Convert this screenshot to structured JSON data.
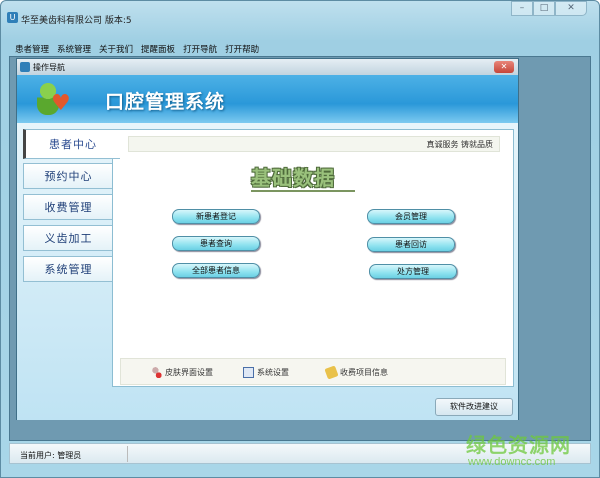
{
  "app": {
    "title": "华至美齿科有限公司  版本:5",
    "controls": {
      "minimize": "–",
      "maximize": "□",
      "close": "✕"
    }
  },
  "menu": [
    "患者管理",
    "系统管理",
    "关于我们",
    "提醒面板",
    "打开导航",
    "打开帮助"
  ],
  "child": {
    "title": "操作导航",
    "close": "✕",
    "banner_title": "口腔管理系统"
  },
  "tabs": [
    "患者中心",
    "预约中心",
    "收费管理",
    "义齿加工",
    "系统管理"
  ],
  "panel": {
    "slogan": "真诚服务  铸就品质",
    "heading": "基础数据",
    "left_buttons": [
      "新患者登记",
      "患者查询",
      "全部患者信息"
    ],
    "right_buttons": [
      "会员管理",
      "患者回访",
      "处方管理"
    ],
    "bottom_links": [
      {
        "label": "皮肤界面设置",
        "icon": "skin-icon"
      },
      {
        "label": "系统设置",
        "icon": "settings-window-icon"
      },
      {
        "label": "收费项目信息",
        "icon": "fee-items-icon"
      }
    ]
  },
  "suggest_button": "软件改进建议",
  "status": {
    "user": "当前用户: 管理员"
  },
  "watermark": {
    "line1": "绿色资源网",
    "line2": "www.downcc.com"
  }
}
